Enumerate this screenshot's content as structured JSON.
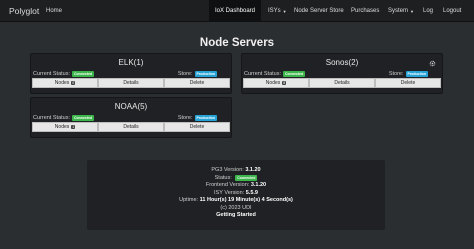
{
  "navbar": {
    "brand": "Polyglot",
    "items": [
      {
        "label": "Home"
      },
      {
        "label": "IoX Dashboard"
      },
      {
        "label": "ISYs"
      },
      {
        "label": "Node Server Store"
      },
      {
        "label": "Purchases"
      },
      {
        "label": "System"
      },
      {
        "label": "Log"
      },
      {
        "label": "Logout"
      }
    ]
  },
  "page": {
    "title": "Node Servers"
  },
  "panels": [
    {
      "title": "ELK(1)",
      "status_label": "Current Status:",
      "status_badge": "Connected",
      "store_label": "Store:",
      "store_badge": "Production",
      "buttons": {
        "nodes": "Nodes",
        "nodes_count": "0",
        "details": "Details",
        "delete": "Delete"
      }
    },
    {
      "title": "Sonos(2)",
      "status_label": "Current Status:",
      "status_badge": "Connected",
      "store_label": "Store:",
      "store_badge": "Production",
      "buttons": {
        "nodes": "Nodes",
        "nodes_count": "8",
        "details": "Details",
        "delete": "Delete"
      }
    },
    {
      "title": "NOAA(5)",
      "status_label": "Current Status:",
      "status_badge": "Connected",
      "store_label": "Store:",
      "store_badge": "Production",
      "buttons": {
        "nodes": "Nodes",
        "nodes_count": "1",
        "details": "Details",
        "delete": "Delete"
      }
    }
  ],
  "info": {
    "pg3_label": "PG3 Version:",
    "pg3_value": "3.1.20",
    "status_label": "Status:",
    "status_badge": "Connected",
    "frontend_label": "Frontend Version:",
    "frontend_value": "3.1.20",
    "isy_label": "ISY Version:",
    "isy_value": "5.5.9",
    "uptime_label": "Uptime:",
    "uptime_value": "11 Hour(s) 19 Minute(s) 4 Second(s)",
    "copyright": "(c) 2023 UDI",
    "getting_started": "Getting Started"
  },
  "colors": {
    "connected": "#3cb54a",
    "production": "#25a3d6",
    "navbar": "#1d1f21",
    "background": "#2b2e31"
  }
}
